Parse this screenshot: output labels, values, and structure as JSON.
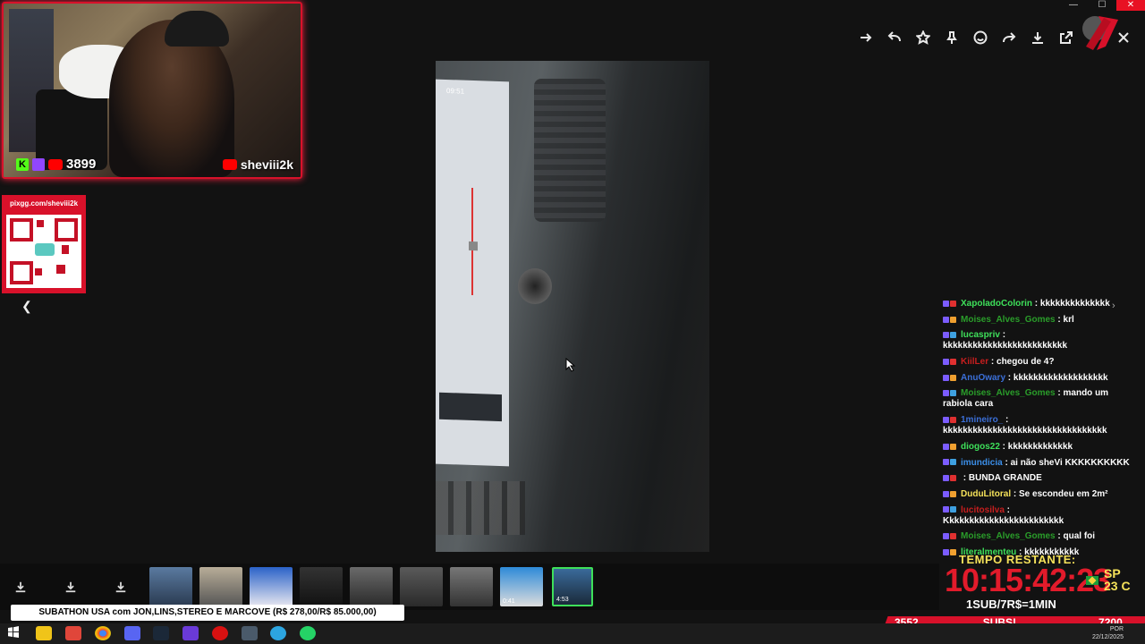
{
  "toolbar": {
    "buttons": [
      "forward-icon",
      "reply-icon",
      "star-icon",
      "pin-icon",
      "emoji-icon",
      "share-icon",
      "download-icon",
      "open-external-icon",
      "close-icon"
    ]
  },
  "window_controls": {
    "minimize": "—",
    "maximize": "☐",
    "close": "✕"
  },
  "webcam": {
    "viewer_count": "3899",
    "channel": "sheviii2k"
  },
  "pix": {
    "url": "pixgg.com/sheviii2k"
  },
  "video": {
    "screen_time": "09:51"
  },
  "chat": {
    "messages": [
      {
        "user": "XapoladoColorin",
        "text": "kkkkkkkkkkkkkk",
        "color": "#3ee05a"
      },
      {
        "user": "Moises_Alves_Gomes",
        "text": "krl",
        "color": "#2a9d2a"
      },
      {
        "user": "lucaspriv",
        "text": "kkkkkkkkkkkkkkkkkkkkkkkkk",
        "color": "#3ee05a"
      },
      {
        "user": "KiilLer",
        "text": "chegou de 4?",
        "color": "#c81e1e"
      },
      {
        "user": "AnuOwary",
        "text": "kkkkkkkkkkkkkkkkkkk",
        "color": "#3b6fd8"
      },
      {
        "user": "Moises_Alves_Gomes",
        "text": "mando um rabiola cara",
        "color": "#2a9d2a"
      },
      {
        "user": "1mineiro_",
        "text": "kkkkkkkkkkkkkkkkkkkkkkkkkkkkkkkkk",
        "color": "#3b6fd8"
      },
      {
        "user": "diogos22",
        "text": "kkkkkkkkkkkkk",
        "color": "#3ee05a"
      },
      {
        "user": "imundicia",
        "text": "ai não sheVi KKKKKKKKKK",
        "color": "#3b8ee8"
      },
      {
        "user": "",
        "text": "BUNDA GRANDE",
        "color": "#1b1bd8"
      },
      {
        "user": "DuduLitoral",
        "text": "Se escondeu em 2m²",
        "color": "#f5e25a"
      },
      {
        "user": "lucitosilva",
        "text": "Kkkkkkkkkkkkkkkkkkkkkkkk",
        "color": "#c81e1e"
      },
      {
        "user": "Moises_Alves_Gomes",
        "text": "qual foi",
        "color": "#2a9d2a"
      },
      {
        "user": "literalmenteu",
        "text": "kkkkkkkkkkk",
        "color": "#3ee05a"
      }
    ]
  },
  "timer": {
    "label": "TEMPO RESTANTE:",
    "time": "10:15:42:23",
    "location": "SP",
    "temp": "23 C",
    "rate": "1SUB/7R$=1MIN"
  },
  "thumbnails": {
    "durations": [
      "0:41",
      "4:53"
    ]
  },
  "ticker": {
    "text": "SUBATHON USA com JON,LINS,STEREO E MARCOVE (R$ 278,00/R$ 85.000,00)"
  },
  "subbar": {
    "left": "3552",
    "center": "SUBS!",
    "right": "7200"
  },
  "taskbar": {
    "lang": "POR",
    "date": "22/12/2025"
  }
}
